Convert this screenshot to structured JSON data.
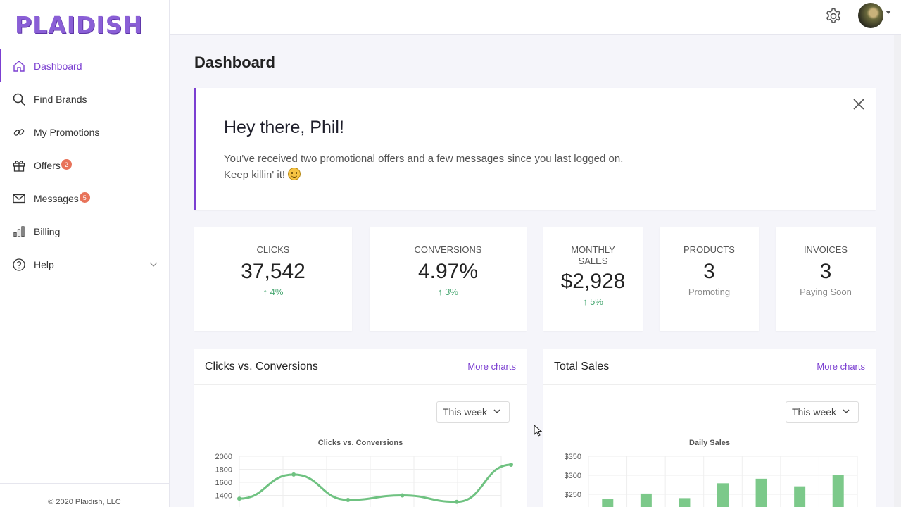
{
  "brand": {
    "logo_text": "PLAIDISH",
    "accent": "#7b3fd1"
  },
  "sidebar": {
    "items": [
      {
        "label": "Dashboard",
        "icon": "home-icon"
      },
      {
        "label": "Find Brands",
        "icon": "search-icon"
      },
      {
        "label": "My Promotions",
        "icon": "link-icon"
      },
      {
        "label": "Offers",
        "icon": "gift-icon",
        "badge": "2"
      },
      {
        "label": "Messages",
        "icon": "mail-icon",
        "badge": "5"
      },
      {
        "label": "Billing",
        "icon": "bar-chart-icon"
      },
      {
        "label": "Help",
        "icon": "help-icon"
      }
    ],
    "copyright": "© 2020 Plaidish, LLC"
  },
  "topbar": {
    "settings_icon": "gear-icon",
    "avatar_icon": "user-avatar"
  },
  "page": {
    "title": "Dashboard"
  },
  "welcome": {
    "heading": "Hey there, Phil!",
    "line1": "You've received two promotional offers and a few messages since you last logged on.",
    "line2": "Keep killin' it!"
  },
  "stats": [
    {
      "label": "CLICKS",
      "value": "37,542",
      "sub": "↑ 4%"
    },
    {
      "label": "CONVERSIONS",
      "value": "4.97%",
      "sub": "↑ 3%"
    },
    {
      "label": "MONTHLY SALES",
      "value": "$2,928",
      "sub": "↑ 5%"
    },
    {
      "label": "PRODUCTS",
      "value": "3",
      "sub": "Promoting"
    },
    {
      "label": "INVOICES",
      "value": "3",
      "sub": "Paying Soon"
    }
  ],
  "cards": {
    "clicks": {
      "title": "Clicks vs. Conversions",
      "link": "More charts",
      "select": "This week"
    },
    "sales": {
      "title": "Total Sales",
      "link": "More charts",
      "select": "This week"
    }
  },
  "chart_data": [
    {
      "type": "line",
      "title": "Clicks vs. Conversions",
      "yticks": [
        "2000",
        "1800",
        "1600",
        "1400"
      ],
      "ylim": [
        1400,
        2000
      ],
      "series": [
        {
          "values": [
            1350,
            1720,
            1330,
            1400,
            1300,
            1870
          ],
          "color": "#6fc281"
        }
      ]
    },
    {
      "type": "bar",
      "title": "Daily Sales",
      "yticks": [
        "$350",
        "$300",
        "$250"
      ],
      "ylim": [
        250,
        350
      ],
      "values": [
        237,
        252,
        240,
        279,
        291,
        271,
        301
      ],
      "color": "#7cc98a"
    }
  ]
}
